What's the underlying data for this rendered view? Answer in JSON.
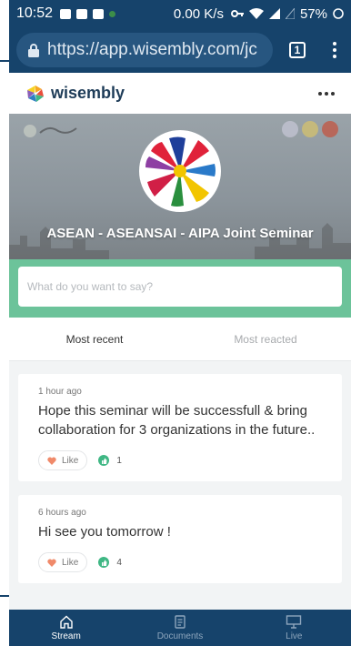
{
  "status_bar": {
    "time": "10:52",
    "network_speed": "0.00 K/s",
    "battery": "57%"
  },
  "browser": {
    "url": "https://app.wisembly.com/jc",
    "tab_count": "1",
    "lock_icon": "lock-icon",
    "menu_icon": "kebab-menu-icon"
  },
  "app_header": {
    "logo_text": "wisembly",
    "more_icon": "more-horizontal-icon"
  },
  "hero": {
    "event_title": "ASEAN - ASEANSAI - AIPA Joint Seminar"
  },
  "composer": {
    "placeholder": "What do you want to say?"
  },
  "tabs": [
    {
      "label": "Most recent",
      "active": true
    },
    {
      "label": "Most reacted",
      "active": false
    }
  ],
  "posts": [
    {
      "time": "1 hour ago",
      "text": "Hope this seminar will be successfull & bring collaboration for 3 organizations in the future..",
      "like_label": "Like",
      "reaction_count": "1"
    },
    {
      "time": "6 hours ago",
      "text": "Hi see you tomorrow !",
      "like_label": "Like",
      "reaction_count": "4"
    }
  ],
  "bottom_nav": [
    {
      "label": "Stream",
      "icon": "home-icon",
      "active": true
    },
    {
      "label": "Documents",
      "icon": "document-icon",
      "active": false
    },
    {
      "label": "Live",
      "icon": "presentation-icon",
      "active": false
    }
  ],
  "colors": {
    "primary": "#16436b",
    "accent_green": "#6cc39a",
    "reaction_green": "#3fb784",
    "like_heart": "#f08a6a"
  }
}
